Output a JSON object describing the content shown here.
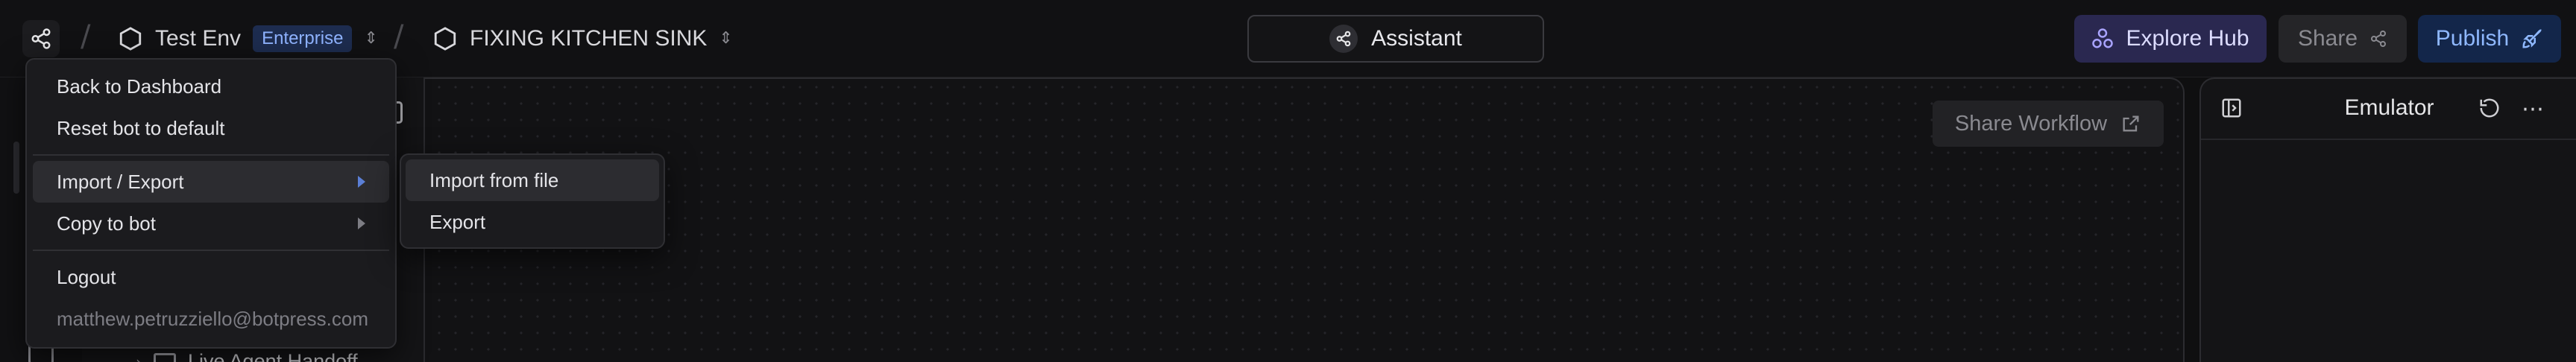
{
  "header": {
    "env_name": "Test Env",
    "env_badge": "Enterprise",
    "bot_name": "FIXING KITCHEN SINK",
    "assistant_label": "Assistant",
    "explore_label": "Explore Hub",
    "share_label": "Share",
    "publish_label": "Publish"
  },
  "canvas": {
    "share_workflow_label": "Share Workflow",
    "tree_item_label": "Live Agent Handoff"
  },
  "emulator": {
    "title": "Emulator"
  },
  "menu": {
    "items": [
      {
        "label": "Back to Dashboard"
      },
      {
        "label": "Reset bot to default"
      },
      {
        "label": "Import / Export"
      },
      {
        "label": "Copy to bot"
      },
      {
        "label": "Logout"
      },
      {
        "label": "matthew.petruzziello@botpress.com"
      }
    ]
  },
  "submenu": {
    "items": [
      {
        "label": "Import from file"
      },
      {
        "label": "Export"
      }
    ]
  },
  "colors": {
    "accent": "#8fb3ff",
    "explore_bg": "#2a2850",
    "publish_bg": "#13264a"
  }
}
